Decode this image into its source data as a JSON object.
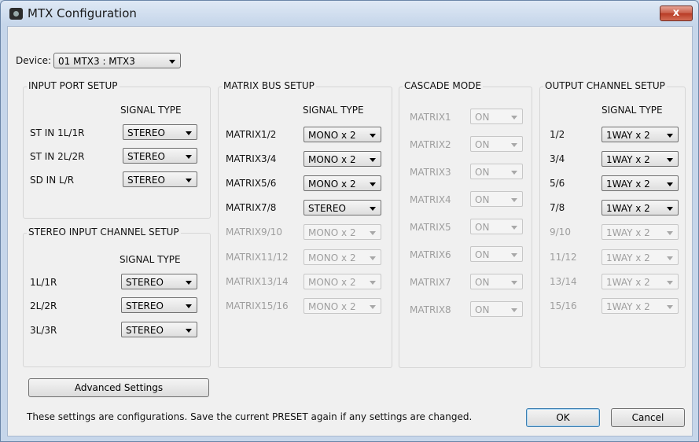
{
  "window": {
    "title": "MTX Configuration",
    "close": "x"
  },
  "device": {
    "label": "Device:",
    "value": "01 MTX3 : MTX3"
  },
  "input_port": {
    "title": "INPUT PORT SETUP",
    "col_header": "SIGNAL TYPE",
    "rows": [
      {
        "label": "ST IN 1L/1R",
        "value": "STEREO"
      },
      {
        "label": "ST IN 2L/2R",
        "value": "STEREO"
      },
      {
        "label": "SD IN L/R",
        "value": "STEREO"
      }
    ]
  },
  "stereo_input": {
    "title": "STEREO INPUT CHANNEL SETUP",
    "col_header": "SIGNAL TYPE",
    "rows": [
      {
        "label": "1L/1R",
        "value": "STEREO"
      },
      {
        "label": "2L/2R",
        "value": "STEREO"
      },
      {
        "label": "3L/3R",
        "value": "STEREO"
      }
    ]
  },
  "matrix_bus": {
    "title": "MATRIX BUS SETUP",
    "col_header": "SIGNAL TYPE",
    "rows": [
      {
        "label": "MATRIX1/2",
        "value": "MONO x 2"
      },
      {
        "label": "MATRIX3/4",
        "value": "MONO x 2"
      },
      {
        "label": "MATRIX5/6",
        "value": "MONO x 2"
      },
      {
        "label": "MATRIX7/8",
        "value": "STEREO"
      },
      {
        "label": "MATRIX9/10",
        "value": "MONO x 2"
      },
      {
        "label": "MATRIX11/12",
        "value": "MONO x 2"
      },
      {
        "label": "MATRIX13/14",
        "value": "MONO x 2"
      },
      {
        "label": "MATRIX15/16",
        "value": "MONO x 2"
      }
    ]
  },
  "cascade": {
    "title": "CASCADE MODE",
    "rows": [
      {
        "label": "MATRIX1",
        "value": "ON"
      },
      {
        "label": "MATRIX2",
        "value": "ON"
      },
      {
        "label": "MATRIX3",
        "value": "ON"
      },
      {
        "label": "MATRIX4",
        "value": "ON"
      },
      {
        "label": "MATRIX5",
        "value": "ON"
      },
      {
        "label": "MATRIX6",
        "value": "ON"
      },
      {
        "label": "MATRIX7",
        "value": "ON"
      },
      {
        "label": "MATRIX8",
        "value": "ON"
      }
    ]
  },
  "output": {
    "title": "OUTPUT CHANNEL SETUP",
    "col_header": "SIGNAL TYPE",
    "rows": [
      {
        "label": "1/2",
        "value": "1WAY x 2"
      },
      {
        "label": "3/4",
        "value": "1WAY x 2"
      },
      {
        "label": "5/6",
        "value": "1WAY x 2"
      },
      {
        "label": "7/8",
        "value": "1WAY x 2"
      },
      {
        "label": "9/10",
        "value": "1WAY x 2"
      },
      {
        "label": "11/12",
        "value": "1WAY x 2"
      },
      {
        "label": "13/14",
        "value": "1WAY x 2"
      },
      {
        "label": "15/16",
        "value": "1WAY x 2"
      }
    ]
  },
  "footer": {
    "advanced": "Advanced Settings",
    "note": "These settings are configurations. Save the current PRESET again if any settings are changed.",
    "ok": "OK",
    "cancel": "Cancel"
  }
}
